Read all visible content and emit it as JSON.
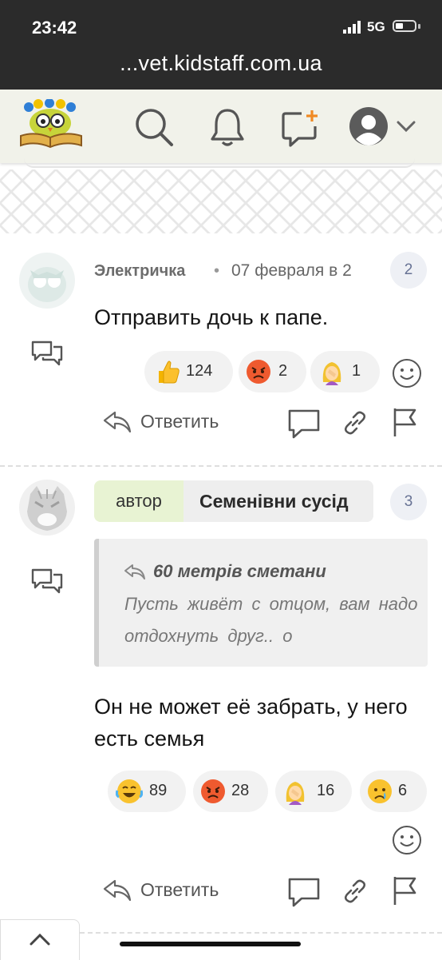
{
  "status_bar": {
    "time": "23:42",
    "network": "5G",
    "battery_level": 0.4,
    "url": "...vet.kidstaff.com.ua"
  },
  "header": {
    "logo_icon": "owl-logo-icon",
    "icons": [
      "search-icon",
      "bell-icon",
      "new-message-icon",
      "user-avatar-icon",
      "chevron-down-icon"
    ],
    "accent_color": "#f08a24"
  },
  "comments": [
    {
      "author": "Электричка",
      "date": "07 февраля в 2",
      "number": "2",
      "text": "Отправить дочь к папе.",
      "reactions": [
        {
          "icon": "thumbs-up-emoji",
          "count": "124"
        },
        {
          "icon": "angry-face-emoji",
          "count": "2"
        },
        {
          "icon": "facepalm-emoji",
          "count": "1"
        }
      ],
      "reply_label": "Ответить"
    },
    {
      "author_tag": "автор",
      "author": "Семенівни сусід",
      "number": "3",
      "quote": {
        "author": "60 метрів сметани",
        "text": "Пусть живёт с отцом, вам надо отдохнуть друг.. о"
      },
      "text": "Он не может её забрать, у него есть семья",
      "reactions": [
        {
          "icon": "laughing-tears-emoji",
          "count": "89"
        },
        {
          "icon": "angry-face-emoji",
          "count": "28"
        },
        {
          "icon": "facepalm-emoji",
          "count": "16"
        },
        {
          "icon": "crying-face-emoji",
          "count": "6"
        }
      ],
      "reply_label": "Ответить"
    }
  ]
}
